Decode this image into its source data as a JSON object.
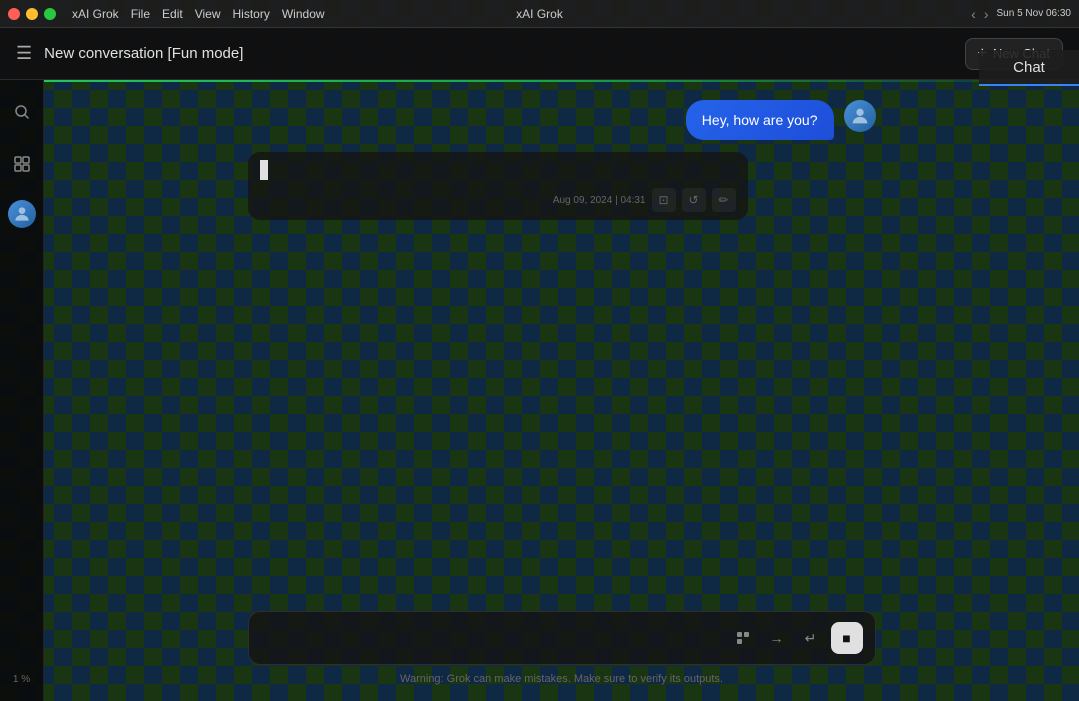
{
  "titlebar": {
    "app_name": "xAI Grok",
    "window_title": "xAI Grok",
    "menu_items": [
      "File",
      "Edit",
      "View",
      "History",
      "Window"
    ],
    "datetime": "Sun 5 Nov  06:30"
  },
  "app_bar": {
    "hamburger_label": "☰",
    "conversation_title": "New conversation [Fun mode]",
    "new_chat_label": "New Chat"
  },
  "sidebar": {
    "search_icon": "🔍",
    "grid_icon": "⊞",
    "percent_label": "1 %"
  },
  "chat": {
    "user_message": "Hey, how are you?",
    "ai_cursor": "|",
    "timestamp": "Aug 09, 2024 | 04:31",
    "action_icons": [
      "⊡",
      "↺",
      "✏"
    ]
  },
  "input": {
    "placeholder": "",
    "warning": "Warning: Grok can make mistakes. Make sure to verify its outputs."
  },
  "chat_panel": {
    "label": "Chat"
  },
  "colors": {
    "accent_green": "#22c55e",
    "accent_blue": "#3b82f6",
    "user_bubble": "#2563eb",
    "bg_dark": "#0a0a0a"
  }
}
